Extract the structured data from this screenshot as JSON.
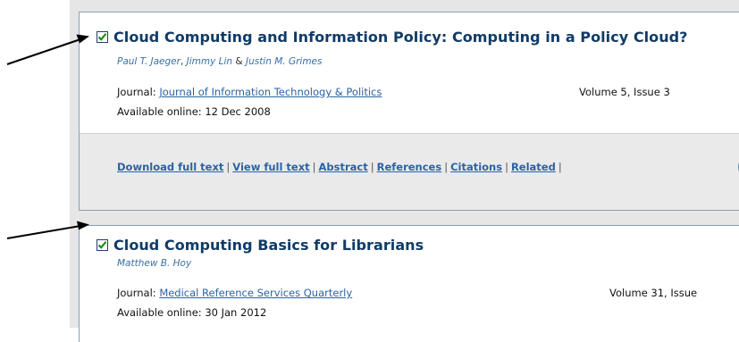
{
  "results": [
    {
      "title": "Cloud Computing and Information Policy: Computing in a Policy Cloud?",
      "authors": [
        "Paul T. Jaeger",
        "Jimmy Lin",
        "Justin M. Grimes"
      ],
      "journal_label": "Journal:",
      "journal": "Journal of Information Technology & Politics",
      "volume": "Volume 5, Issue 3",
      "online_label": "Available online:",
      "online_date": "12 Dec 2008",
      "checked": true
    },
    {
      "title": "Cloud Computing Basics for Librarians",
      "authors": [
        "Matthew B. Hoy"
      ],
      "journal_label": "Journal:",
      "journal": "Medical Reference Services Quarterly",
      "volume": "Volume 31, Issue",
      "online_label": "Available online:",
      "online_date": "30 Jan 2012",
      "checked": true
    }
  ],
  "links": {
    "download": "Download full text",
    "view": "View full text",
    "abstract": "Abstract",
    "references": "References",
    "citations": "Citations",
    "related": "Related",
    "button_text": "Ch"
  },
  "icons": {
    "checkbox": "checkmark-icon",
    "annotation": "arrow-icon"
  },
  "colors": {
    "title": "#103b66",
    "link": "#2b63a3",
    "author": "#3a6fa7",
    "check": "#0a8a0a",
    "border": "#8a9fb4"
  }
}
